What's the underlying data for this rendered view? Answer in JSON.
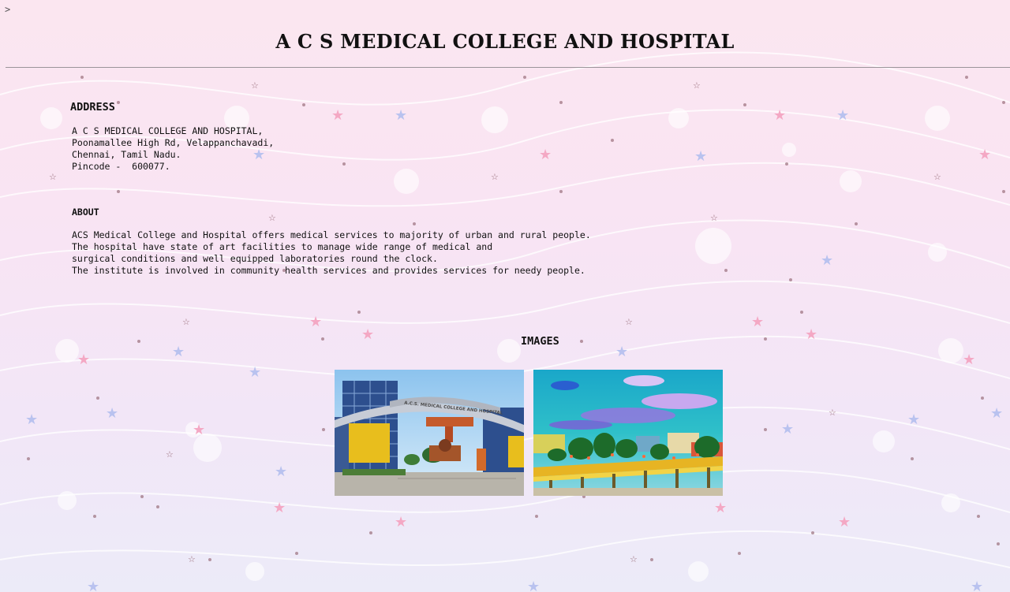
{
  "chevron": ">",
  "title": "A C S MEDICAL COLLEGE AND HOSPITAL",
  "address": {
    "heading": "ADDRESS",
    "lines": [
      "A C S MEDICAL COLLEGE AND HOSPITAL,",
      "Poonamallee High Rd, Velappanchavadi,",
      "Chennai, Tamil Nadu.",
      "Pincode -  600077."
    ]
  },
  "about": {
    "heading": "ABOUT",
    "lines": [
      "ACS Medical College and Hospital offers medical services to majority of urban and rural people.",
      "The hospital have state of art facilities to manage wide range of medical and",
      "surgical conditions and well equipped laboratories round the clock.",
      "The institute is involved in community health services and provides services for needy people."
    ]
  },
  "images": {
    "heading": "IMAGES",
    "gate_sign": "A.C.S. MEDICAL COLLEGE AND HOSPITAL"
  }
}
